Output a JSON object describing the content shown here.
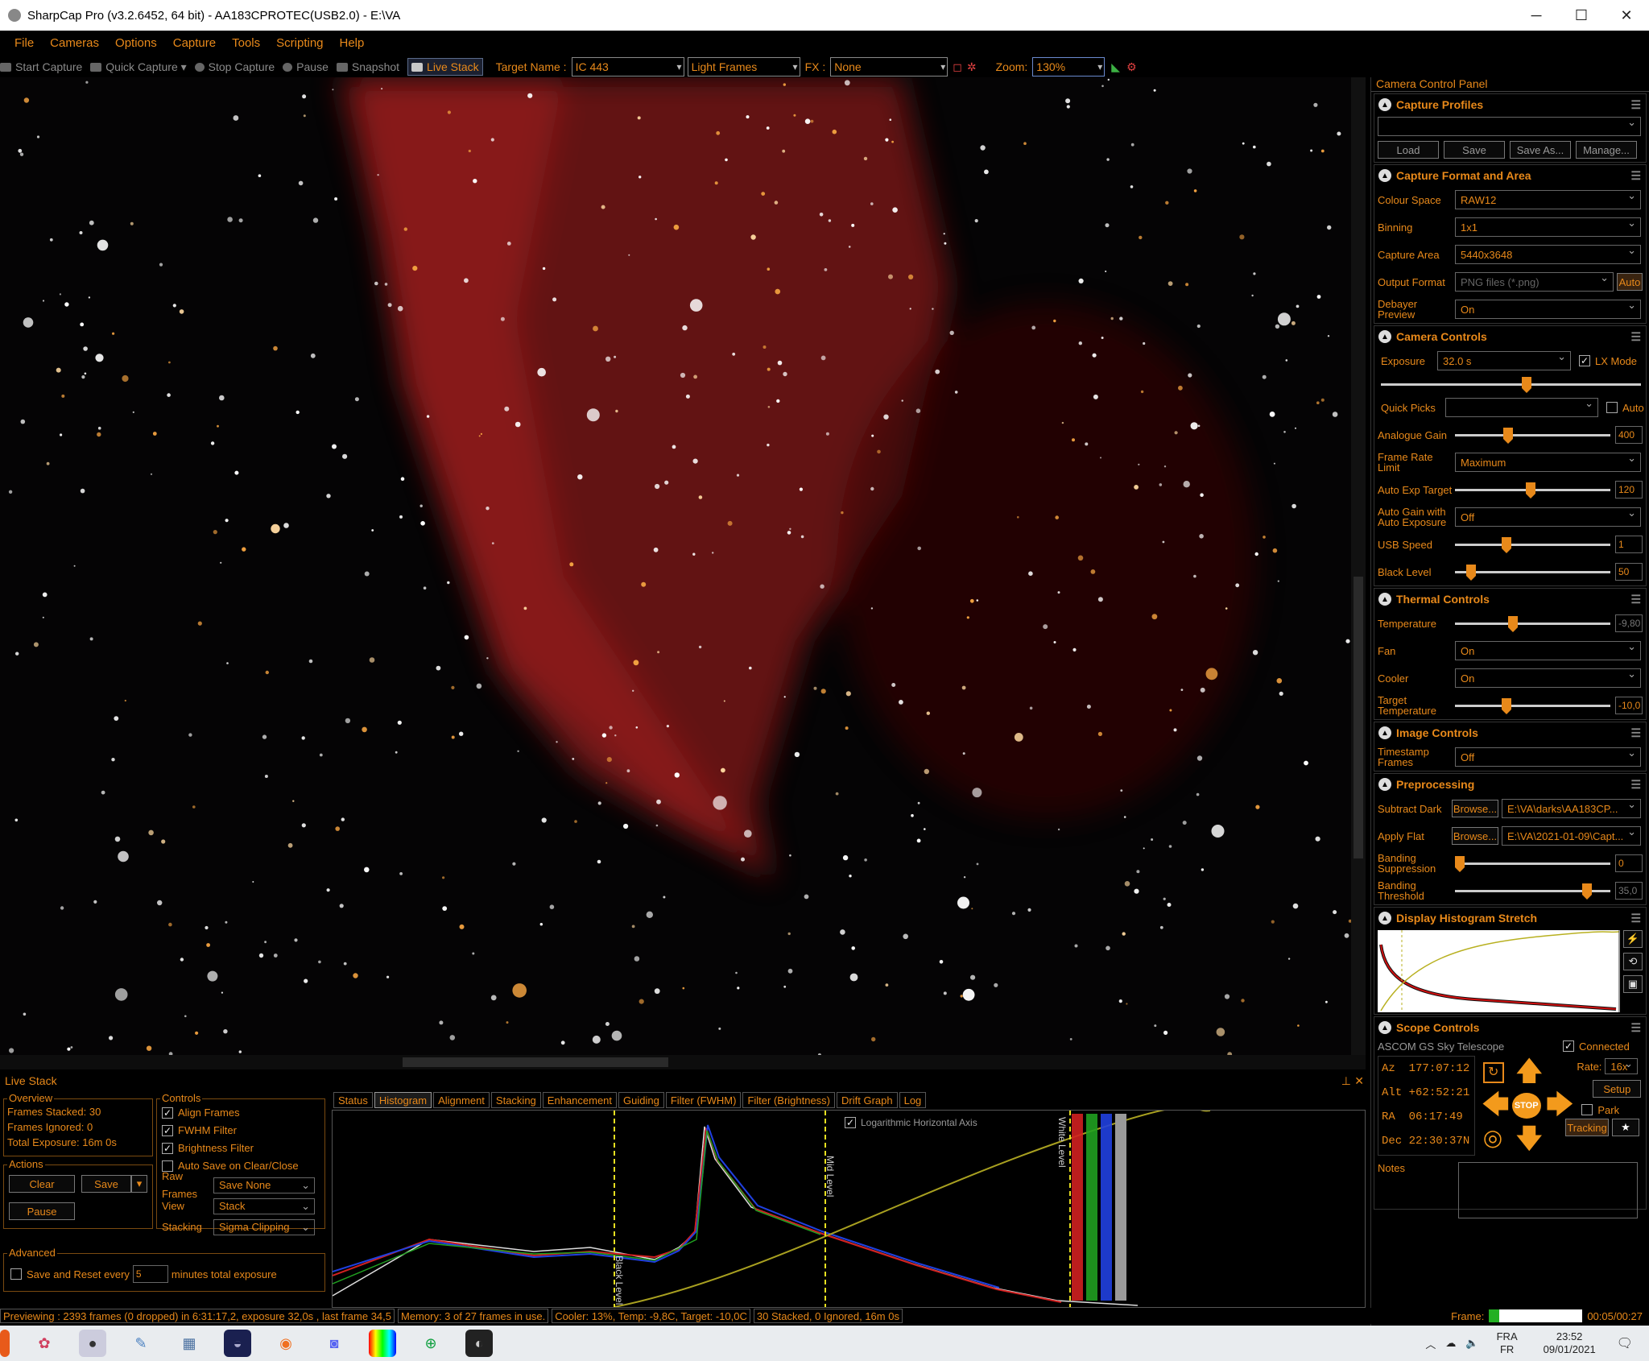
{
  "window": {
    "title": "SharpCap Pro (v3.2.6452, 64 bit) - AA183CPROTEC(USB2.0) - E:\\VA",
    "minimize": "─",
    "maximize": "☐",
    "close": "✕"
  },
  "menu": [
    "File",
    "Cameras",
    "Options",
    "Capture",
    "Tools",
    "Scripting",
    "Help"
  ],
  "toolbar": {
    "start_capture": "Start Capture",
    "quick_capture": "Quick Capture",
    "stop_capture": "Stop Capture",
    "pause": "Pause",
    "snapshot": "Snapshot",
    "live_stack": "Live Stack",
    "target_name_label": "Target Name :",
    "target_name": "IC 443",
    "frame_type": "Light Frames",
    "fx_label": "FX :",
    "fx_value": "None",
    "zoom_label": "Zoom:",
    "zoom_value": "130%"
  },
  "camera_panel": {
    "title": "Camera Control Panel",
    "capture_profiles": {
      "title": "Capture Profiles",
      "profile": "",
      "load": "Load",
      "save": "Save",
      "save_as": "Save As...",
      "manage": "Manage..."
    },
    "format": {
      "title": "Capture Format and Area",
      "colour_space_label": "Colour Space",
      "colour_space": "RAW12",
      "binning_label": "Binning",
      "binning": "1x1",
      "capture_area_label": "Capture Area",
      "capture_area": "5440x3648",
      "output_format_label": "Output Format",
      "output_format": "PNG files (*.png)",
      "auto": "Auto",
      "debayer_label": "Debayer Preview",
      "debayer": "On"
    },
    "camera": {
      "title": "Camera Controls",
      "exposure_label": "Exposure",
      "exposure": "32.0 s",
      "lx_mode": "LX Mode",
      "quick_picks_label": "Quick Picks",
      "quick_picks_auto": "Auto",
      "gain_label": "Analogue Gain",
      "gain": "400",
      "frame_rate_label": "Frame Rate Limit",
      "frame_rate": "Maximum",
      "auto_exp_label": "Auto Exp Target",
      "auto_exp": "120",
      "auto_gain_label": "Auto Gain with Auto Exposure",
      "auto_gain": "Off",
      "usb_label": "USB Speed",
      "usb": "1",
      "black_label": "Black Level",
      "black": "50"
    },
    "thermal": {
      "title": "Thermal Controls",
      "temperature_label": "Temperature",
      "temperature": "-9,80",
      "fan_label": "Fan",
      "fan": "On",
      "cooler_label": "Cooler",
      "cooler": "On",
      "target_temp_label": "Target Temperature",
      "target_temp": "-10,0"
    },
    "image": {
      "title": "Image Controls",
      "timestamp_label": "Timestamp Frames",
      "timestamp": "Off"
    },
    "preprocessing": {
      "title": "Preprocessing",
      "dark_label": "Subtract Dark",
      "browse": "Browse...",
      "dark": "E:\\VA\\darks\\AA183CP...",
      "flat_label": "Apply Flat",
      "flat": "E:\\VA\\2021-01-09\\Capt...",
      "banding_sup_label": "Banding Suppression",
      "banding_sup": "0",
      "banding_thr_label": "Banding Threshold",
      "banding_thr": "35,0"
    },
    "histogram": {
      "title": "Display Histogram Stretch"
    },
    "scope": {
      "title": "Scope Controls",
      "name": "ASCOM GS Sky Telescope",
      "connected": "Connected",
      "az_label": "Az",
      "az": "177:07:12",
      "alt_label": "Alt",
      "alt": "+62:52:21",
      "ra_label": "RA",
      "ra": "06:17:49",
      "dec_label": "Dec",
      "dec": "22:30:37N",
      "rate_label": "Rate:",
      "rate": "16x",
      "setup": "Setup",
      "park": "Park",
      "stop": "STOP",
      "tracking": "Tracking",
      "notes": "Notes"
    }
  },
  "live_stack": {
    "title": "Live Stack",
    "overview": {
      "title": "Overview",
      "stacked": "Frames Stacked:  30",
      "ignored": "Frames Ignored:  0",
      "exposure": "Total Exposure:   16m 0s"
    },
    "actions": {
      "title": "Actions",
      "clear": "Clear",
      "save": "Save",
      "pause": "Pause"
    },
    "controls": {
      "title": "Controls",
      "align": "Align Frames",
      "fwhm": "FWHM Filter",
      "brightness": "Brightness Filter",
      "autosave": "Auto Save on Clear/Close",
      "raw_label": "Raw Frames",
      "raw": "Save None",
      "view_label": "View",
      "view": "Stack",
      "stacking_label": "Stacking",
      "stacking": "Sigma Clipping"
    },
    "advanced": {
      "title": "Advanced",
      "reset_label": "Save and Reset every",
      "reset_value": "5",
      "reset_suffix": "minutes total exposure"
    },
    "tabs": [
      "Status",
      "Histogram",
      "Alignment",
      "Stacking",
      "Enhancement",
      "Guiding",
      "Filter (FWHM)",
      "Filter (Brightness)",
      "Drift Graph",
      "Log"
    ],
    "histogram": {
      "log_axis": "Logarithmic Horizontal Axis",
      "black_level": "Black Level",
      "mid_level": "Mid Level",
      "white_level": "White Level"
    }
  },
  "status": {
    "preview": "Previewing : 2393 frames (0 dropped) in 6:31:17,2, exposure 32,0s , last frame 34,5",
    "memory": "Memory: 3 of 27 frames in use.",
    "cooler": "Cooler: 13%, Temp: -9,8C, Target: -10,0C",
    "stacked": "30 Stacked, 0 Ignored, 16m 0s",
    "frame_label": "Frame:",
    "frame_time": "00:05/00:27",
    "frame_progress": 0.11
  },
  "taskbar": {
    "lang": "FRA",
    "lang2": "FR",
    "time": "23:52",
    "date": "09/01/2021"
  },
  "colors": {
    "accent": "#e8891a",
    "background": "#000000",
    "nebula": "#8a1a1a"
  }
}
